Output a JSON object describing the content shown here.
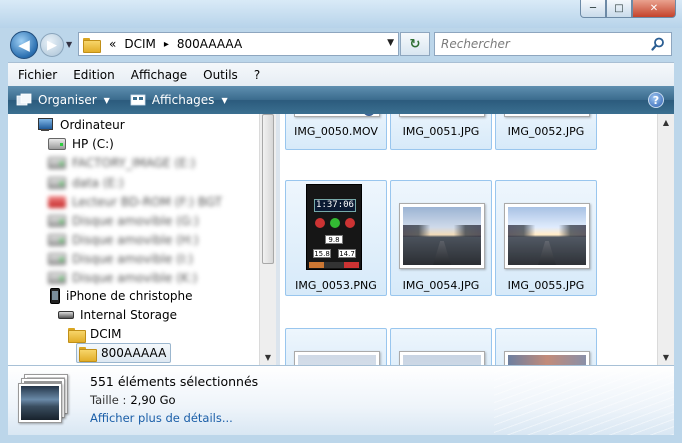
{
  "window": {
    "min": "─",
    "max": "□",
    "close": "✕"
  },
  "nav": {
    "back": "◀",
    "forward": "▶",
    "dropdown": "▼"
  },
  "address": {
    "chevron": "«",
    "crumbs": [
      "DCIM",
      "800AAAAA"
    ],
    "separator": "▸",
    "dropdown": "▼",
    "refresh": "↻"
  },
  "search": {
    "placeholder": "Rechercher"
  },
  "menu": [
    "Fichier",
    "Edition",
    "Affichage",
    "Outils",
    "?"
  ],
  "commands": {
    "organise": "Organiser",
    "views": "Affichages",
    "dropdown": "▼",
    "help": "?"
  },
  "tree": {
    "computer": "Ordinateur",
    "hp_drive": "HP (C:)",
    "blurred": [
      "FACTORY_IMAGE (E:)",
      "data (E:)",
      "Lecteur BD-ROM (F:) BGT",
      "Disque amovible (G:)",
      "Disque amovible (H:)",
      "Disque amovible (I:)",
      "Disque amovible (K:)"
    ],
    "phone": "iPhone de christophe",
    "storage": "Internal Storage",
    "dcim": "DCIM",
    "selected": "800AAAAA"
  },
  "files": [
    {
      "name": "IMG_0050.MOV"
    },
    {
      "name": "IMG_0051.JPG"
    },
    {
      "name": "IMG_0052.JPG"
    },
    {
      "name": "IMG_0053.PNG"
    },
    {
      "name": "IMG_0054.JPG"
    },
    {
      "name": "IMG_0055.JPG"
    }
  ],
  "app_screenshot": {
    "time": "1:37:06",
    "v1": "9.8",
    "v2": "15.8",
    "v3": "14.7"
  },
  "scroll": {
    "up": "▲",
    "down": "▼"
  },
  "details": {
    "title": "551 éléments sélectionnés",
    "size_label": "Taille :",
    "size_value": "2,90 Go",
    "more": "Afficher plus de détails..."
  },
  "colors": {
    "accent": "#1a5ea8",
    "command_bar": "#3a6b8d",
    "selection": "#d7eaf9"
  }
}
